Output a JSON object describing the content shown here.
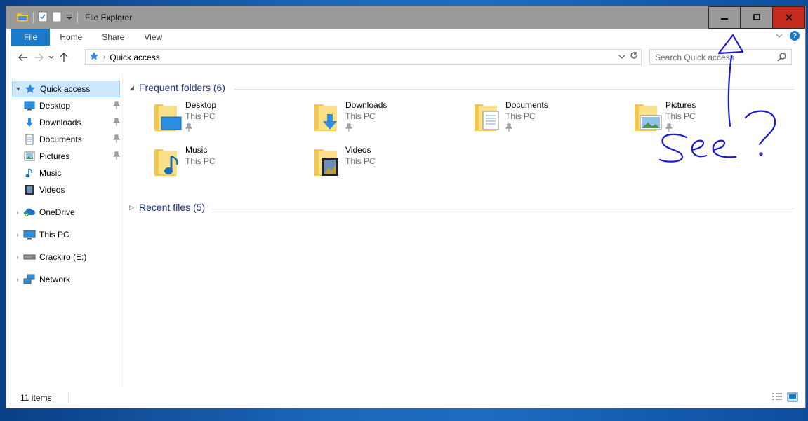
{
  "window": {
    "title": "File Explorer"
  },
  "ribbon": {
    "tabs": [
      "File",
      "Home",
      "Share",
      "View"
    ],
    "help_label": "?"
  },
  "address_bar": {
    "location": "Quick access"
  },
  "search": {
    "placeholder": "Search Quick access"
  },
  "nav_pane": {
    "quick_access": "Quick access",
    "quick_items": [
      {
        "label": "Desktop",
        "icon": "desktop-icon",
        "pinned": true
      },
      {
        "label": "Downloads",
        "icon": "downloads-icon",
        "pinned": true
      },
      {
        "label": "Documents",
        "icon": "documents-icon",
        "pinned": true
      },
      {
        "label": "Pictures",
        "icon": "pictures-icon",
        "pinned": true
      },
      {
        "label": "Music",
        "icon": "music-icon",
        "pinned": false
      },
      {
        "label": "Videos",
        "icon": "videos-icon",
        "pinned": false
      }
    ],
    "roots": [
      {
        "label": "OneDrive",
        "icon": "onedrive-icon"
      },
      {
        "label": "This PC",
        "icon": "this-pc-icon"
      },
      {
        "label": "Crackiro (E:)",
        "icon": "drive-icon"
      },
      {
        "label": "Network",
        "icon": "network-icon"
      }
    ]
  },
  "content": {
    "frequent_header": "Frequent folders (6)",
    "recent_header": "Recent files (5)",
    "folders": [
      {
        "name": "Desktop",
        "location": "This PC",
        "pinned": true
      },
      {
        "name": "Downloads",
        "location": "This PC",
        "pinned": true
      },
      {
        "name": "Documents",
        "location": "This PC",
        "pinned": true
      },
      {
        "name": "Pictures",
        "location": "This PC",
        "pinned": true
      },
      {
        "name": "Music",
        "location": "This PC",
        "pinned": false
      },
      {
        "name": "Videos",
        "location": "This PC",
        "pinned": false
      }
    ]
  },
  "status_bar": {
    "item_count": "11 items"
  },
  "colors": {
    "accent": "#1979ca",
    "titlebar": "#9a9a9a",
    "close_button": "#c42b1c",
    "selection": "#cce8ff",
    "annotation_ink": "#1a1ad6"
  }
}
